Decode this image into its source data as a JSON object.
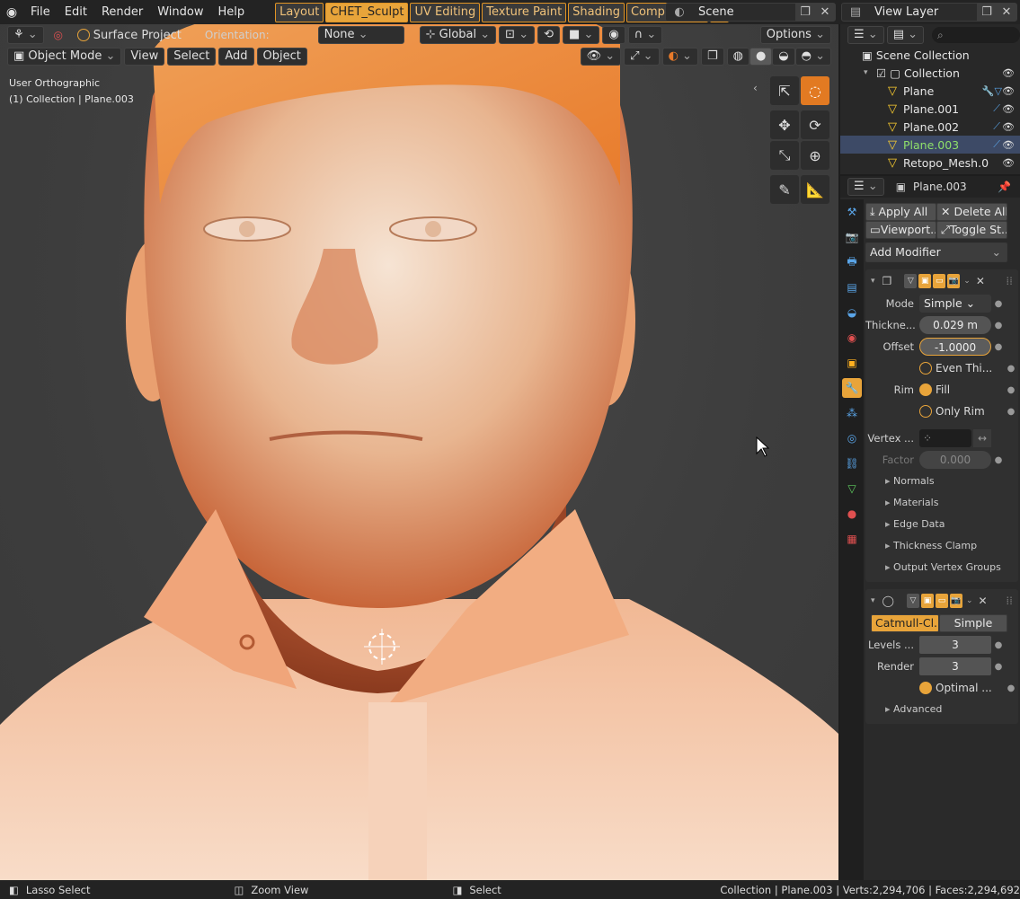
{
  "topbar": {
    "menus": [
      "File",
      "Edit",
      "Render",
      "Window",
      "Help"
    ],
    "workspaces": [
      "Layout",
      "CHET_Sculpt",
      "UV Editing",
      "Texture Paint",
      "Shading",
      "Compositing",
      "+"
    ],
    "active_workspace": "CHET_Sculpt",
    "scene": "Scene",
    "view_layer": "View Layer"
  },
  "viewport": {
    "header1": {
      "snap_label": "Surface Project",
      "orientation_label": "Orientation:",
      "orientation_value": "None",
      "transform_space": "Global",
      "options": "Options"
    },
    "header2": {
      "mode": "Object Mode",
      "menus": [
        "View",
        "Select",
        "Add",
        "Object"
      ]
    },
    "overlay_line1": "User Orthographic",
    "overlay_line2": "(1) Collection | Plane.003"
  },
  "outliner": {
    "root": "Scene Collection",
    "collection": "Collection",
    "items": [
      {
        "name": "Plane",
        "selected": false
      },
      {
        "name": "Plane.001",
        "selected": false
      },
      {
        "name": "Plane.002",
        "selected": false
      },
      {
        "name": "Plane.003",
        "selected": true
      },
      {
        "name": "Retopo_Mesh.0",
        "selected": false
      }
    ]
  },
  "properties": {
    "object_name": "Plane.003",
    "apply_all": "Apply All",
    "delete_all": "Delete All",
    "viewport": "Viewport...",
    "toggle": "Toggle St...",
    "add_modifier": "Add Modifier",
    "solidify": {
      "mode_label": "Mode",
      "mode_value": "Simple",
      "thickness_label": "Thickne...",
      "thickness_value": "0.029 m",
      "offset_label": "Offset",
      "offset_value": "-1.0000",
      "even_label": "Even Thi...",
      "rim_label": "Rim",
      "fill_label": "Fill",
      "only_rim_label": "Only Rim",
      "vertex_label": "Vertex ...",
      "factor_label": "Factor",
      "factor_value": "0.000",
      "subpanels": [
        "Normals",
        "Materials",
        "Edge Data",
        "Thickness Clamp",
        "Output Vertex Groups"
      ]
    },
    "subsurf": {
      "type_a": "Catmull-Cl...",
      "type_b": "Simple",
      "levels_label": "Levels ...",
      "levels_value": "3",
      "render_label": "Render",
      "render_value": "3",
      "optimal_label": "Optimal ...",
      "advanced": "Advanced"
    }
  },
  "statusbar": {
    "lasso": "Lasso Select",
    "zoom": "Zoom View",
    "select": "Select",
    "info": "Collection | Plane.003 | Verts:2,294,706 | Faces:2,294,692"
  }
}
